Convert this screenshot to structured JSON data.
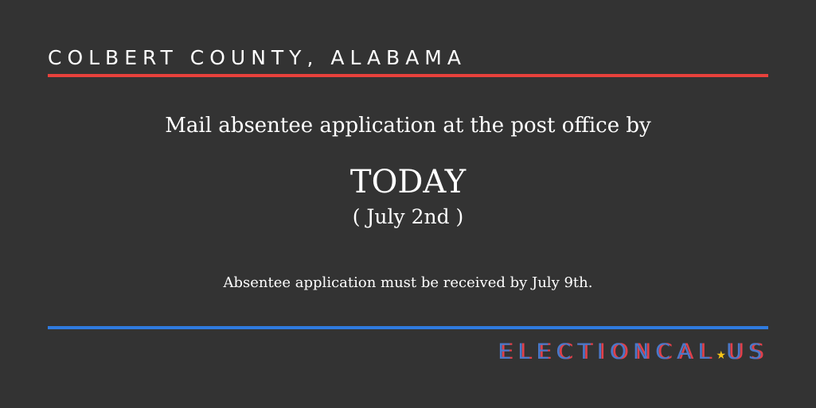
{
  "header": {
    "county": "COLBERT COUNTY, ALABAMA"
  },
  "main": {
    "lead": "Mail absentee application at the post office by",
    "deadline": "TODAY",
    "date": "( July 2nd )",
    "note": "Absentee application must be received by July 9th."
  },
  "logo": {
    "name": "ELECTIONCAL",
    "star": "★",
    "tld": "US"
  },
  "colors": {
    "background": "#333333",
    "red": "#e8413c",
    "blue": "#2f7be0",
    "star": "#f5c518"
  }
}
